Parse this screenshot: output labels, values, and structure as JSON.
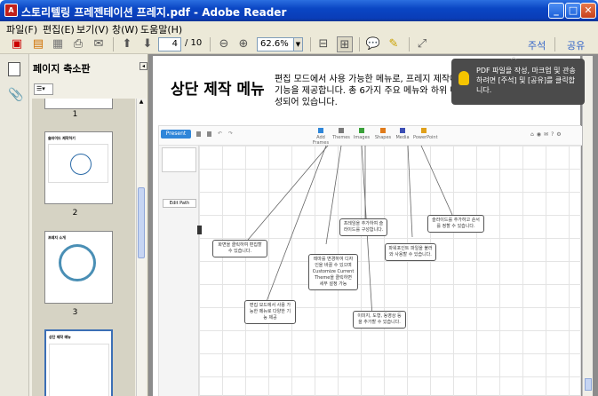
{
  "window": {
    "title": "스토리텔링 프레젠테이션 프레지.pdf - Adobe Reader",
    "buttons": {
      "minimize": "_",
      "maximize": "□",
      "close": "✕"
    }
  },
  "menu": [
    "파일(F)",
    "편집(E)",
    "보기(V)",
    "창(W)",
    "도움말(H)"
  ],
  "toolbar": {
    "page_current": "4",
    "page_total": "/ 10",
    "zoom": "62.6%",
    "comment_link": "주석",
    "share_link": "공유"
  },
  "panel": {
    "title": "페이지 축소판",
    "thumbnails": [
      {
        "num": "1"
      },
      {
        "num": "2",
        "title": "슬라이드 제작하기"
      },
      {
        "num": "3",
        "title": "프레지 소개"
      },
      {
        "num": "4",
        "title": "상단 제작 메뉴"
      }
    ]
  },
  "slide": {
    "title": "상단 제작 메뉴",
    "description": "편집 모드에서 사용 가능한 메뉴로, 프레지 제작에 필요한 기능을 제공합니다. 총 6가지 주요 메뉴와 하위 메뉴로 구성되어 있습니다."
  },
  "prezi": {
    "present": "Present",
    "tabs": [
      "Add Frames",
      "Themes",
      "Images",
      "Shapes",
      "Media",
      "PowerPoint"
    ],
    "edit_path": "Edit Path",
    "notes": [
      "화면을 클릭하여 편집할 수 있습니다.",
      "편집 모드에서 사용 가능한 메뉴로 다양한 기능 제공",
      "프레임을 추가하여 슬라이드를 구성합니다.",
      "테마를 변경하여 디자인을 바꿀 수 있으며 Customize Current Theme을 클릭하면 세부 설정 가능",
      "이미지, 도형, 동영상 등을 추가할 수 있습니다.",
      "파워포인트 파일을 불러와 사용할 수 있습니다.",
      "슬라이드를 추가하고 순서를 정할 수 있습니다."
    ]
  },
  "tooltip": {
    "text": "PDF 파일을 작성, 마크업 및 관송하려면 [주석] 및 [공유]를 클릭합니다."
  }
}
